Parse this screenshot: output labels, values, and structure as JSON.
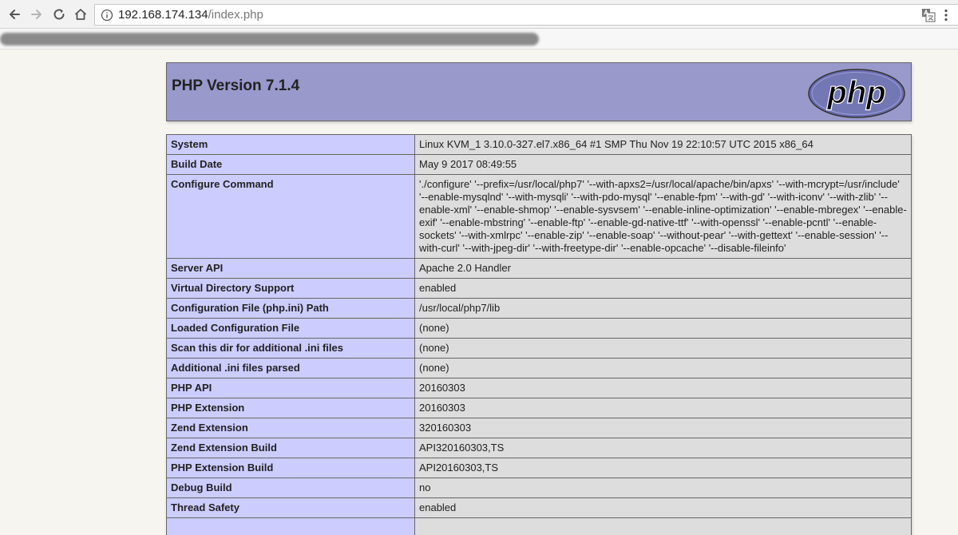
{
  "browser": {
    "url_host": "192.168.174.134",
    "url_path": "/index.php"
  },
  "page": {
    "title": "PHP Version 7.1.4",
    "logo_text": "php",
    "rows": [
      {
        "key": "System",
        "value": "Linux KVM_1 3.10.0-327.el7.x86_64 #1 SMP Thu Nov 19 22:10:57 UTC 2015 x86_64"
      },
      {
        "key": "Build Date",
        "value": "May 9 2017 08:49:55"
      },
      {
        "key": "Configure Command",
        "value": "'./configure' '--prefix=/usr/local/php7' '--with-apxs2=/usr/local/apache/bin/apxs' '--with-mcrypt=/usr/include' '--enable-mysqlnd' '--with-mysqli' '--with-pdo-mysql' '--enable-fpm' '--with-gd' '--with-iconv' '--with-zlib' '--enable-xml' '--enable-shmop' '--enable-sysvsem' '--enable-inline-optimization' '--enable-mbregex' '--enable-exif' '--enable-mbstring' '--enable-ftp' '--enable-gd-native-ttf' '--with-openssl' '--enable-pcntl' '--enable-sockets' '--with-xmlrpc' '--enable-zip' '--enable-soap' '--without-pear' '--with-gettext' '--enable-session' '--with-curl' '--with-jpeg-dir' '--with-freetype-dir' '--enable-opcache' '--disable-fileinfo'"
      },
      {
        "key": "Server API",
        "value": "Apache 2.0 Handler"
      },
      {
        "key": "Virtual Directory Support",
        "value": "enabled"
      },
      {
        "key": "Configuration File (php.ini) Path",
        "value": "/usr/local/php7/lib"
      },
      {
        "key": "Loaded Configuration File",
        "value": "(none)"
      },
      {
        "key": "Scan this dir for additional .ini files",
        "value": "(none)"
      },
      {
        "key": "Additional .ini files parsed",
        "value": "(none)"
      },
      {
        "key": "PHP API",
        "value": "20160303"
      },
      {
        "key": "PHP Extension",
        "value": "20160303"
      },
      {
        "key": "Zend Extension",
        "value": "320160303"
      },
      {
        "key": "Zend Extension Build",
        "value": "API320160303,TS"
      },
      {
        "key": "PHP Extension Build",
        "value": "API20160303,TS"
      },
      {
        "key": "Debug Build",
        "value": "no"
      },
      {
        "key": "Thread Safety",
        "value": "enabled"
      },
      {
        "key": "",
        "value": ""
      }
    ]
  },
  "colors": {
    "header_bg": "#9999cc",
    "key_cell_bg": "#ccccff",
    "value_cell_bg": "#dddddd",
    "page_bg": "#f7f5ef"
  }
}
